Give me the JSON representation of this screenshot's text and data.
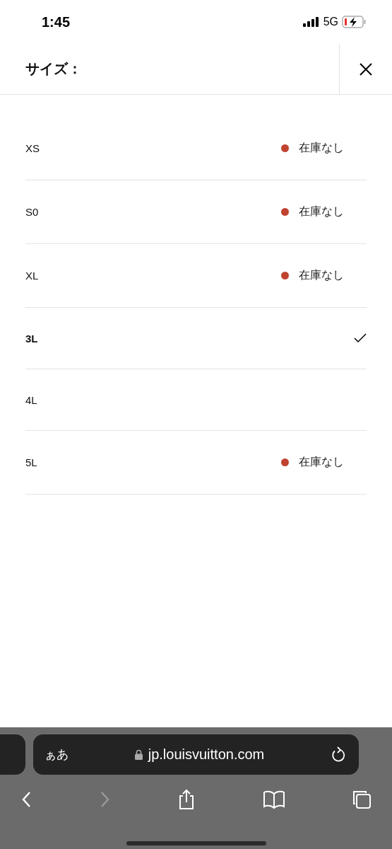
{
  "status_bar": {
    "time": "1:45",
    "network": "5G"
  },
  "header": {
    "title": "サイズ："
  },
  "sizes": [
    {
      "label": "XS",
      "status": "在庫なし",
      "color": "#c0432f",
      "selected": false
    },
    {
      "label": "S0",
      "status": "在庫なし",
      "color": "#c0432f",
      "selected": false
    },
    {
      "label": "XL",
      "status": "在庫なし",
      "color": "#c0432f",
      "selected": false
    },
    {
      "label": "3L",
      "selected": true
    },
    {
      "label": "4L",
      "selected": false
    },
    {
      "label": "5L",
      "status": "在庫なし",
      "color": "#c0432f",
      "selected": false
    }
  ],
  "browser": {
    "text_size": "ぁあ",
    "url": "jp.louisvuitton.com",
    "nav": [
      {
        "kind": "back",
        "disabled": false
      },
      {
        "kind": "forward",
        "disabled": true
      },
      {
        "kind": "share",
        "disabled": false
      },
      {
        "kind": "bookmarks",
        "disabled": false
      },
      {
        "kind": "tabs",
        "disabled": false
      }
    ]
  }
}
